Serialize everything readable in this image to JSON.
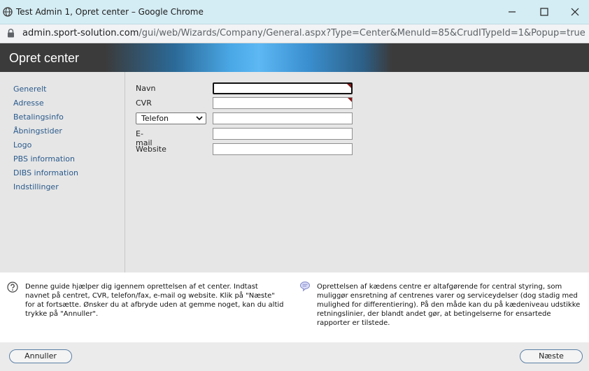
{
  "window": {
    "title": "Test Admin 1, Opret center – Google Chrome",
    "url_host": "admin.sport-solution.com",
    "url_path": "/gui/web/Wizards/Company/General.aspx?Type=Center&MenuId=85&CrudITypeId=1&Popup=true"
  },
  "header": {
    "title": "Opret center"
  },
  "sidebar": {
    "items": [
      {
        "label": "Generelt"
      },
      {
        "label": "Adresse"
      },
      {
        "label": "Betalingsinfo"
      },
      {
        "label": "Åbningstider"
      },
      {
        "label": "Logo"
      },
      {
        "label": "PBS information"
      },
      {
        "label": "DIBS information"
      },
      {
        "label": "Indstillinger"
      }
    ]
  },
  "form": {
    "name_label": "Navn",
    "name_value": "",
    "cvr_label": "CVR",
    "cvr_value": "",
    "phone_type_selected": "Telefon",
    "phone_value": "",
    "email_label": "E-mail",
    "email_value": "",
    "website_label": "Website",
    "website_value": ""
  },
  "help": {
    "left": "Denne guide hjælper dig igennem oprettelsen af et center. Indtast navnet på centret, CVR, telefon/fax, e-mail og website. Klik på \"Næste\" for at fortsætte. Ønsker du at afbryde uden at gemme noget, kan du altid trykke på \"Annuller\".",
    "right": "Oprettelsen af kædens centre er altafgørende for central styring, som muliggør ensretning af centrenes varer og serviceydelser (dog stadig med mulighed for differentiering). På den måde kan du på kædeniveau udstikke retningslinier, der blandt andet gør, at betingelserne for ensartede rapporter er tilstede."
  },
  "footer": {
    "cancel_label": "Annuller",
    "next_label": "Næste"
  },
  "icons": {
    "favicon": "globe-icon",
    "lock": "lock-icon",
    "help": "question-icon",
    "info": "speech-bubble-icon"
  },
  "colors": {
    "header_bg": "#3b3b3b",
    "header_accent": "#5db8f3",
    "panel_bg": "#e6e6e6",
    "link": "#2a5a8c",
    "required_marker": "#8b1a1a"
  }
}
